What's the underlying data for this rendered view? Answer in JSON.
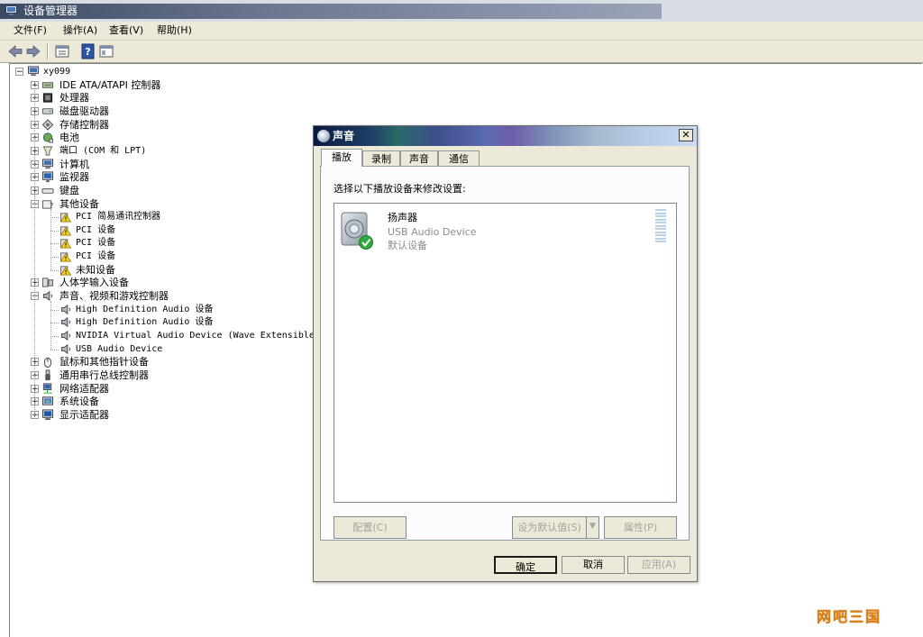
{
  "window": {
    "title": "设备管理器"
  },
  "menu": [
    "文件(F)",
    "操作(A)",
    "查看(V)",
    "帮助(H)"
  ],
  "toolbar": {
    "buttons": [
      "back-icon",
      "forward-icon",
      "properties-icon",
      "help-icon",
      "view-icon"
    ]
  },
  "tree": {
    "root": "xy099",
    "items": [
      "IDE ATA/ATAPI 控制器",
      "处理器",
      "磁盘驱动器",
      "存储控制器",
      "电池",
      "端口 (COM 和 LPT)",
      "计算机",
      "监视器",
      "键盘",
      "其他设备",
      "PCI 简易通讯控制器",
      "PCI 设备",
      "PCI 设备",
      "PCI 设备",
      "未知设备",
      "人体学输入设备",
      "声音、视频和游戏控制器",
      "High Definition Audio 设备",
      "High Definition Audio 设备",
      "NVIDIA Virtual Audio Device (Wave Extensible) (W",
      "USB Audio Device",
      "鼠标和其他指针设备",
      "通用串行总线控制器",
      "网络适配器",
      "系统设备",
      "显示适配器"
    ]
  },
  "dialog": {
    "title": "声音",
    "close": "✕",
    "tabs": [
      "播放",
      "录制",
      "声音",
      "通信"
    ],
    "instruction": "选择以下播放设备来修改设置:",
    "device": {
      "name": "扬声器",
      "desc": "USB Audio Device",
      "status": "默认设备"
    },
    "buttons": {
      "configure": "配置(C)",
      "set_default": "设为默认值(S)",
      "properties": "属性(P)",
      "ok": "确定",
      "cancel": "取消",
      "apply": "应用(A)"
    }
  },
  "watermark": "网吧三国",
  "colors": {
    "tree_lines": "#999999",
    "dialog_face": "#ece9d8",
    "meter": "#b9d2ea",
    "watermark": "#f3a64a"
  }
}
